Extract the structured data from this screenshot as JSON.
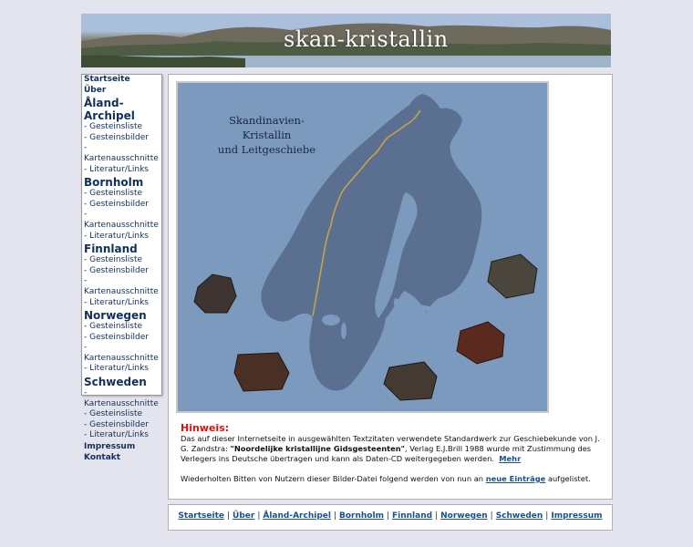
{
  "banner": {
    "title": "skan-kristallin"
  },
  "sidebar": {
    "start": "Startseite",
    "about": "Über",
    "sections": [
      {
        "title": "Åland-Archipel",
        "items": [
          "- Gesteinsliste",
          "- Gesteinsbilder",
          "- Kartenausschnitte",
          "- Literatur/Links"
        ]
      },
      {
        "title": "Bornholm",
        "items": [
          "- Gesteinsliste",
          "- Gesteinsbilder",
          "- Kartenausschnitte",
          "- Literatur/Links"
        ]
      },
      {
        "title": "Finnland",
        "items": [
          "- Gesteinsliste",
          "- Gesteinsbilder",
          "- Kartenausschnitte",
          "- Literatur/Links"
        ]
      },
      {
        "title": "Norwegen",
        "items": [
          "- Gesteinsliste",
          "- Gesteinsbilder",
          "- Kartenausschnitte",
          "- Literatur/Links"
        ]
      },
      {
        "title": "Schweden",
        "items": [
          "- Kartenausschnitte",
          "- Gesteinsliste",
          "- Gesteinsbilder",
          "- Literatur/Links"
        ]
      }
    ],
    "impressum": "Impressum",
    "kontakt": "Kontakt"
  },
  "map": {
    "title_line1": "Skandinavien-Kristallin",
    "title_line2": "und Leitgeschiebe"
  },
  "notice": {
    "label": "Hinweis",
    "colon": ":",
    "text1": "Das auf dieser Internetseite in ausgewählten Textzitaten verwendete Standardwerk zur Geschiebekunde von J. G. Zandstra: ",
    "book": "\"Noordelijke kristallijne Gidsgesteenten\"",
    "text2": ", Verlag E.J.Brill 1988 wurde mit Zustimmung des Verlegers ins Deutsche übertragen und kann als Daten-CD weitergegeben werden.",
    "more": "Mehr",
    "text3": "Wiederholten Bitten von Nutzern dieser Bilder-Datei folgend werden von nun an ",
    "new_entries": "neue Einträge",
    "text4": " aufgelistet."
  },
  "footer": {
    "links": [
      "Startseite",
      "Über",
      "Åland-Archipel",
      "Bornholm",
      "Finnland",
      "Norwegen",
      "Schweden",
      "Impressum"
    ],
    "separator": "|"
  }
}
